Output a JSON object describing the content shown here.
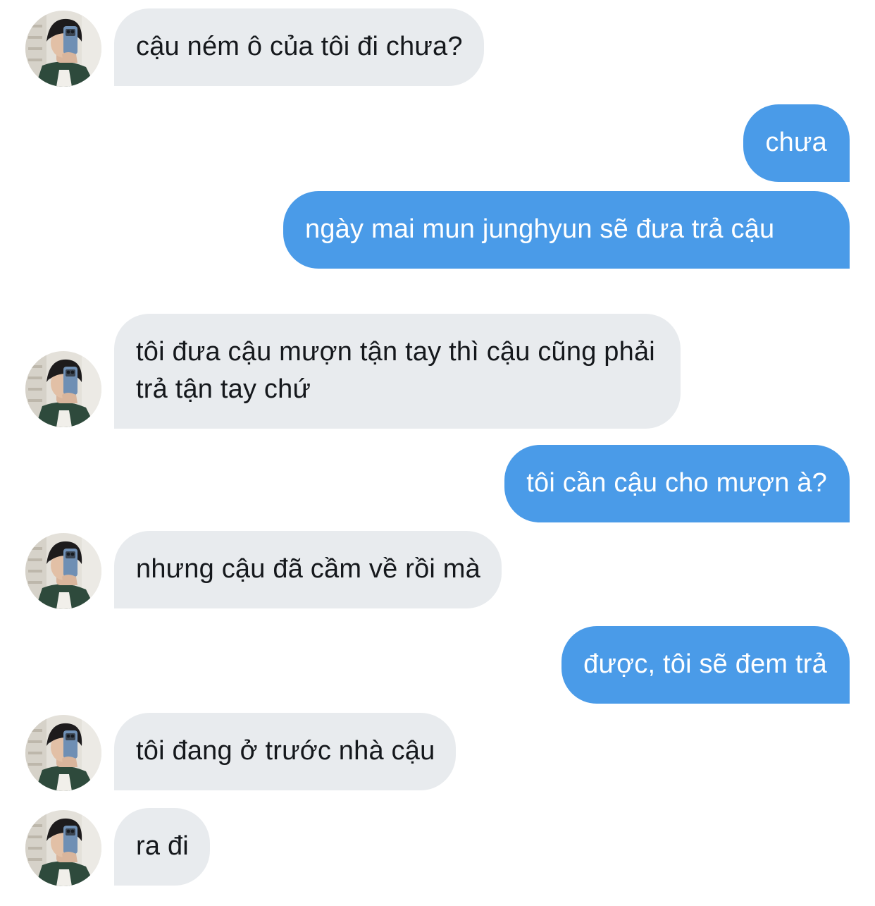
{
  "conversation": {
    "messages": [
      {
        "sender": "them",
        "text": "cậu ném ô của tôi đi chưa?"
      },
      {
        "sender": "me",
        "text": "chưa"
      },
      {
        "sender": "me",
        "text": "ngày mai mun junghyun sẽ đưa trả cậu"
      },
      {
        "sender": "them",
        "text": "tôi đưa cậu mượn tận tay thì cậu cũng phải trả tận tay chứ"
      },
      {
        "sender": "me",
        "text": "tôi cần cậu cho mượn à?"
      },
      {
        "sender": "them",
        "text": "nhưng cậu đã cầm về rồi mà"
      },
      {
        "sender": "me",
        "text": "được, tôi sẽ đem trả"
      },
      {
        "sender": "them",
        "text": "tôi đang ở trước nhà cậu"
      },
      {
        "sender": "them",
        "text": "ra đi"
      }
    ]
  },
  "colors": {
    "incoming_bubble": "#e8ebee",
    "outgoing_bubble": "#4a9be8",
    "incoming_text": "#15181c",
    "outgoing_text": "#ffffff"
  },
  "icons": {
    "avatar": "contact-avatar-photo"
  }
}
